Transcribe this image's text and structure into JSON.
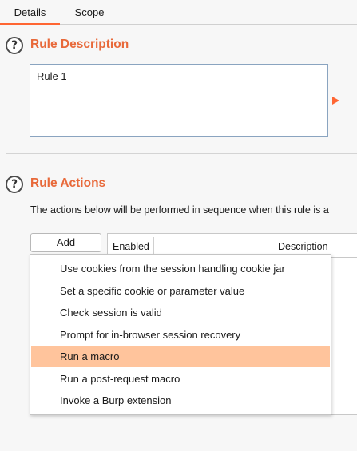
{
  "tabs": [
    {
      "label": "Details",
      "active": true
    },
    {
      "label": "Scope",
      "active": false
    }
  ],
  "rule_description": {
    "title": "Rule Description",
    "value": "Rule 1"
  },
  "rule_actions": {
    "title": "Rule Actions",
    "intro": "The actions below will be performed in sequence when this rule is a",
    "add_label": "Add",
    "table": {
      "columns": [
        "Enabled",
        "Description"
      ]
    }
  },
  "add_menu": {
    "items": [
      {
        "label": "Use cookies from the session handling cookie jar",
        "selected": false
      },
      {
        "label": "Set a specific cookie or parameter value",
        "selected": false
      },
      {
        "label": "Check session is valid",
        "selected": false
      },
      {
        "label": "Prompt for in-browser session recovery",
        "selected": false
      },
      {
        "label": "Run a macro",
        "selected": true
      },
      {
        "label": "Run a post-request macro",
        "selected": false
      },
      {
        "label": "Invoke a Burp extension",
        "selected": false
      }
    ]
  },
  "icons": {
    "help": "help-question-icon",
    "expand": "expand-arrow-icon"
  },
  "colors": {
    "accent": "#ff6633",
    "section_title": "#e8693a",
    "menu_highlight": "#ffc49c"
  }
}
